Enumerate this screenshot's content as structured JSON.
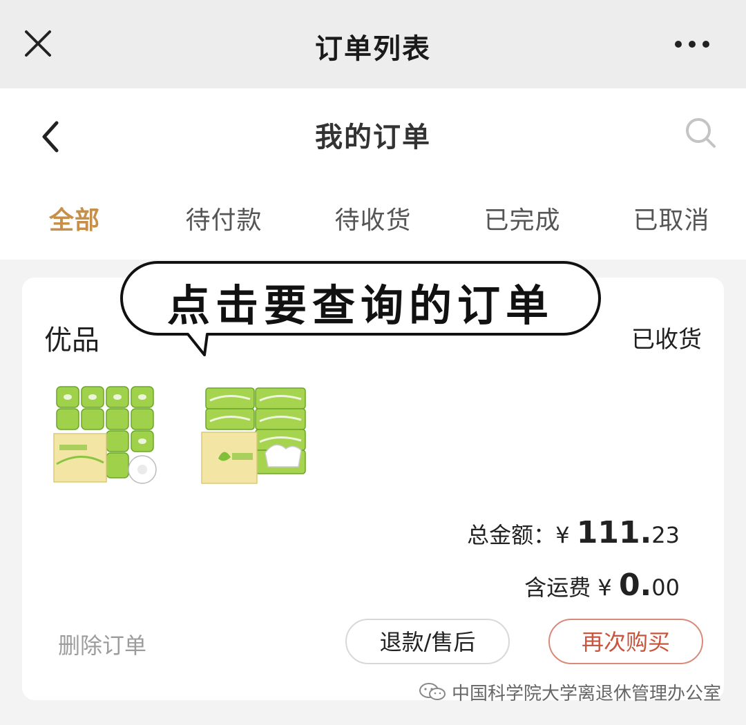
{
  "window": {
    "title": "订单列表",
    "close_icon": "close-icon",
    "more_icon": "more-dots-icon"
  },
  "header": {
    "title": "我的订单",
    "back_icon": "chevron-left-icon",
    "search_icon": "search-icon"
  },
  "tabs": [
    {
      "label": "全部",
      "active": true
    },
    {
      "label": "待付款",
      "active": false
    },
    {
      "label": "待收货",
      "active": false
    },
    {
      "label": "已完成",
      "active": false
    },
    {
      "label": "已取消",
      "active": false
    }
  ],
  "order": {
    "shop": "优品",
    "status": "已收货",
    "total_label": "总金额：",
    "currency": "¥",
    "total_int": "111.",
    "total_dec": "23",
    "ship_label": "含运费",
    "ship_int": "0.",
    "ship_dec": "00",
    "delete_label": "删除订单",
    "refund_label": "退款/售后",
    "rebuy_label": "再次购买"
  },
  "annotation": {
    "bubble_text": "点击要查询的订单"
  },
  "watermark": {
    "text": "中国科学院大学离退休管理办公室"
  },
  "colors": {
    "active_tab": "#c7904a",
    "rebuy_border": "#d9897a",
    "rebuy_text": "#c8553e",
    "product_green": "#8bc53f"
  }
}
